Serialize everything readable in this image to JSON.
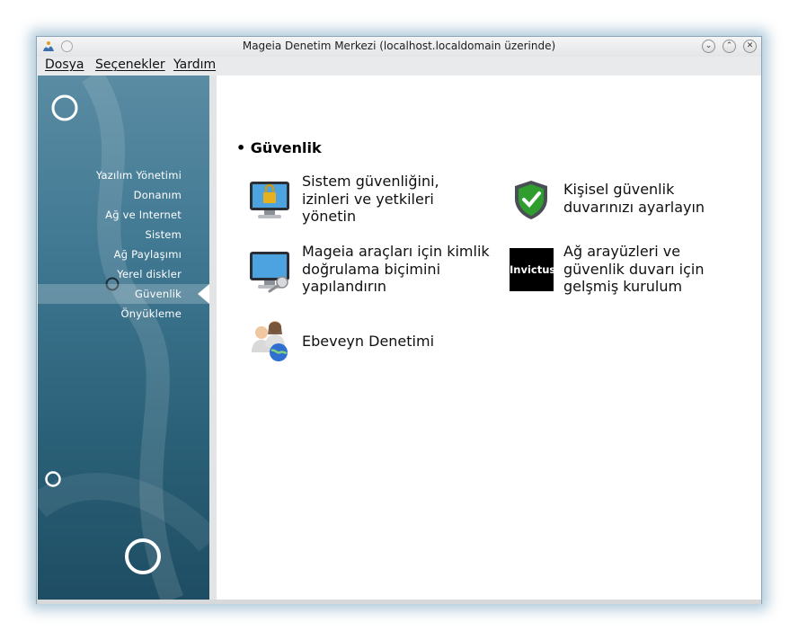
{
  "window": {
    "title": "Mageia Denetim Merkezi  (localhost.localdomain üzerinde)",
    "controls": [
      "minimize",
      "maximize",
      "close"
    ]
  },
  "menubar": {
    "items": [
      "Dosya",
      "Seçenekler",
      "Yardım"
    ]
  },
  "sidebar": {
    "items": [
      "Yazılım Yönetimi",
      "Donanım",
      "Ağ ve Internet",
      "Sistem",
      "Ağ Paylaşımı",
      "Yerel diskler",
      "Güvenlik",
      "Önyükleme"
    ],
    "active_index": 6
  },
  "content": {
    "section_title": "Güvenlik",
    "items": [
      {
        "label": "Sistem güvenliğini, izinleri ve yetkileri yönetin",
        "icon": "monitor-lock-icon"
      },
      {
        "label": "Kişisel güvenlik duvarınızı ayarlayın",
        "icon": "shield-check-icon"
      },
      {
        "label": "Mageia araçları için kimlik doğrulama biçimini yapılandırın",
        "icon": "monitor-key-icon"
      },
      {
        "label": "Ağ arayüzleri ve güvenlik duvarı için gelşmiş kurulum",
        "icon": "invictus-icon",
        "icon_text": "Invictus"
      },
      {
        "label": "Ebeveyn Denetimi",
        "icon": "parents-globe-icon"
      }
    ]
  },
  "colors": {
    "sidebar_top": "#5a8ca3",
    "sidebar_bottom": "#1e4d63",
    "content_bg": "#ffffff",
    "shield_green": "#2f9e2f"
  }
}
